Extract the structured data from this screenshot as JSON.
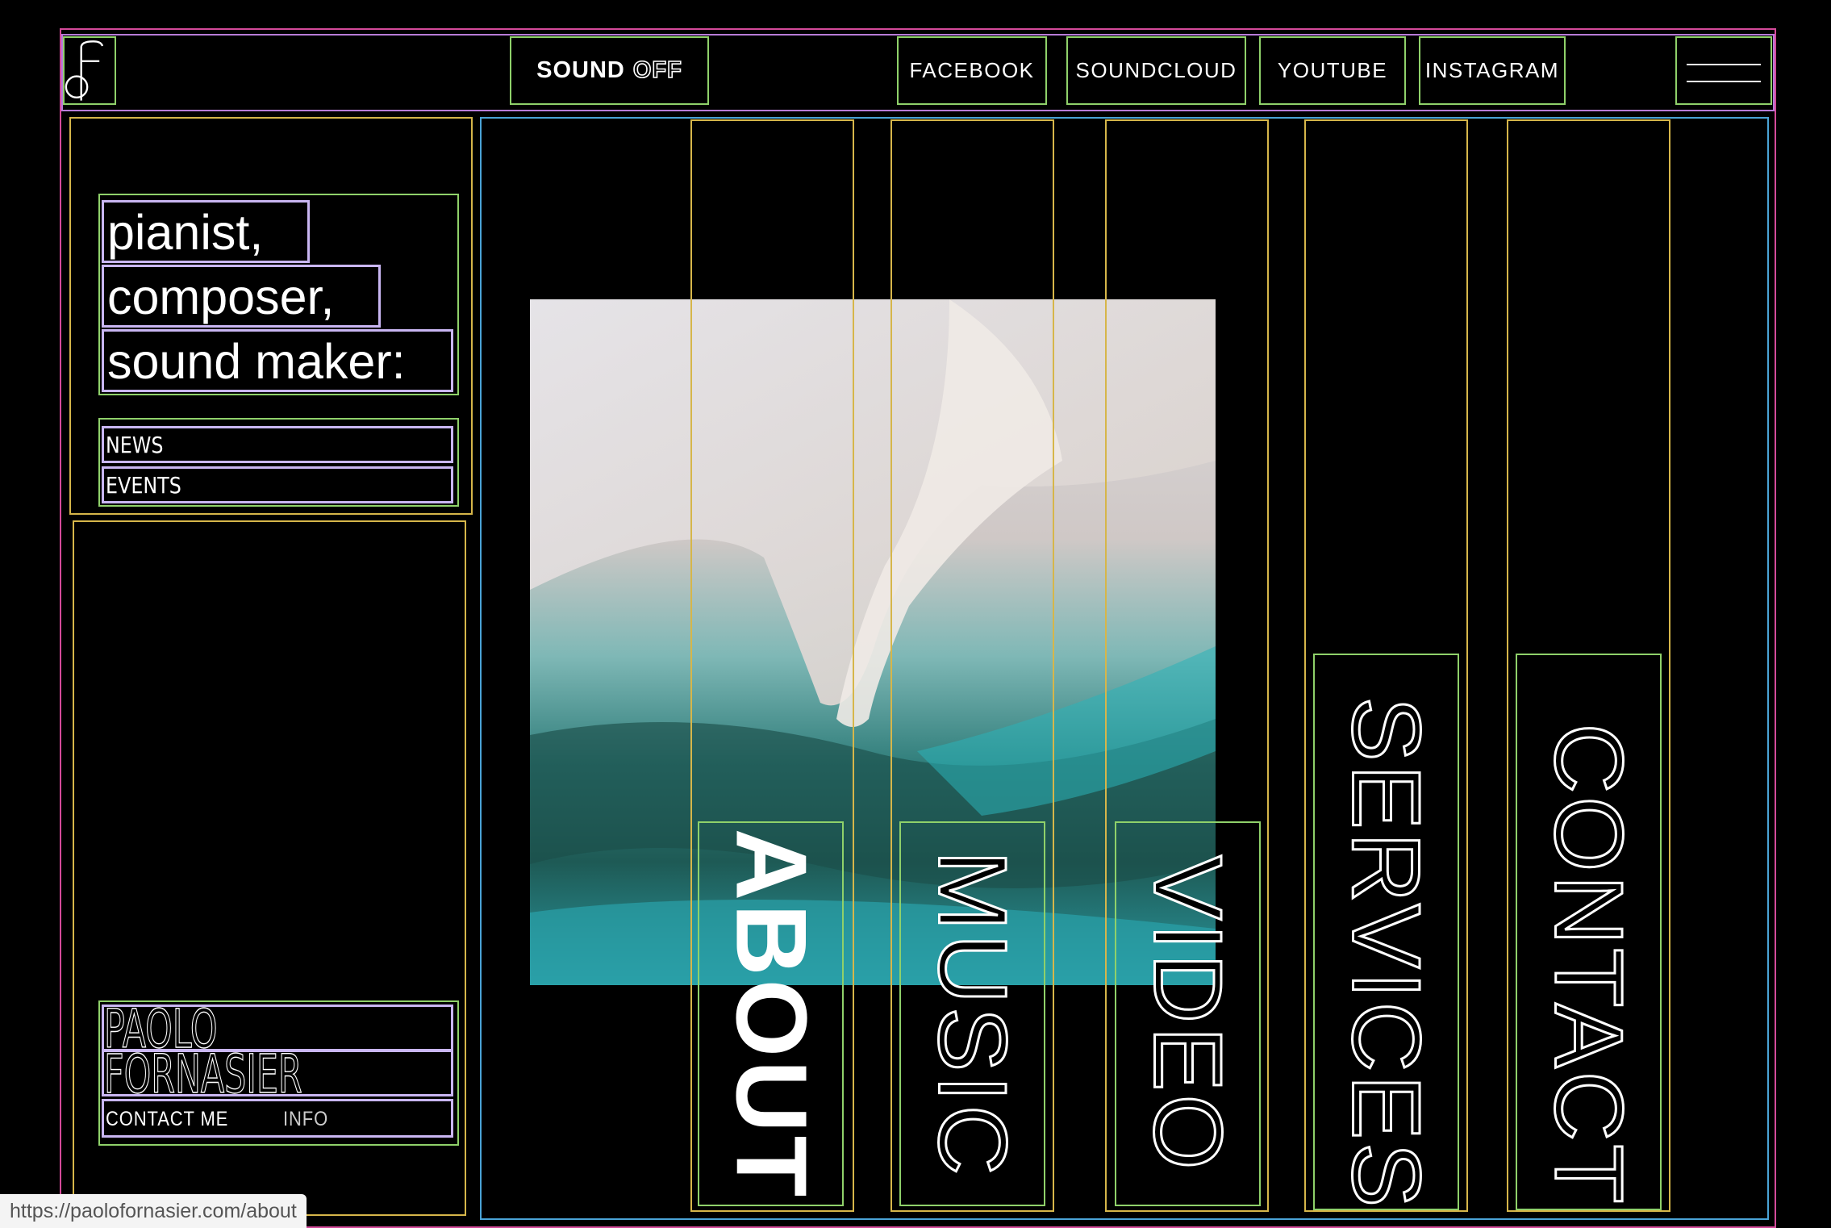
{
  "header": {
    "brand_main": "SOUND",
    "brand_off": "OFF",
    "social": [
      "FACEBOOK",
      "SOUNDCLOUD",
      "YOUTUBE",
      "INSTAGRAM"
    ]
  },
  "sidebar": {
    "tagline": [
      "pianist,",
      "composer,",
      "sound maker:"
    ],
    "nav": [
      "NEWS",
      "EVENTS"
    ],
    "name": [
      "PAOLO",
      "FORNASIER"
    ],
    "contact_label": "CONTACT ME",
    "info_label": "INFO"
  },
  "main": {
    "sections": [
      "ABOUT",
      "MUSIC",
      "VIDEO",
      "SERVICES",
      "CONTACT"
    ]
  },
  "status_bar": {
    "url": "https://paolofornasier.com/about"
  },
  "colors": {
    "background": "#000000",
    "outline_pink": "#d44a9a",
    "outline_green": "#8fd16a",
    "outline_yellow": "#d6b64a",
    "outline_blue": "#4aa3d6",
    "outline_lavender": "#c9b6f2"
  }
}
